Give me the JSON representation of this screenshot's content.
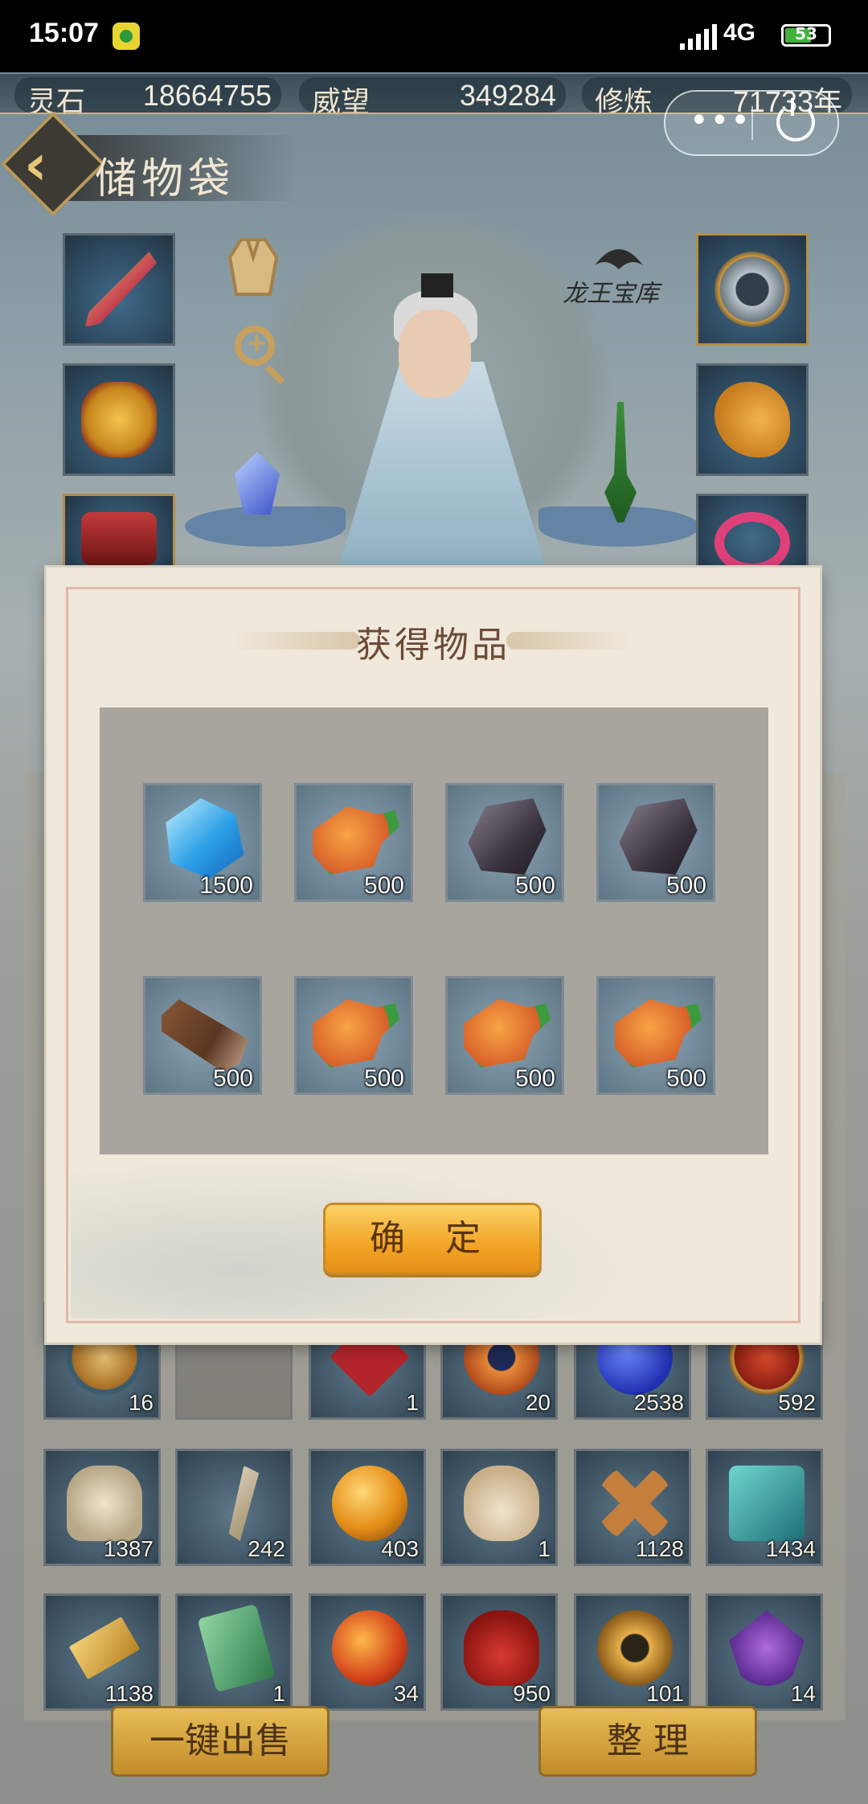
{
  "status_bar": {
    "time": "15:07",
    "network": "4G",
    "battery": "53"
  },
  "resources": [
    {
      "label": "灵石",
      "value": "18664755"
    },
    {
      "label": "威望",
      "value": "349284"
    },
    {
      "label": "修炼",
      "value": "71733年"
    }
  ],
  "header": {
    "title": "储物袋",
    "vault_label": "龙王宝库"
  },
  "capsule": {
    "more": "•••"
  },
  "modal": {
    "title": "获得物品",
    "confirm_label": "确 定",
    "items": [
      {
        "icon": "blue-crystal",
        "count": "1500"
      },
      {
        "icon": "roast-meat",
        "count": "500"
      },
      {
        "icon": "dark-ore",
        "count": "500"
      },
      {
        "icon": "dark-ore",
        "count": "500"
      },
      {
        "icon": "wood-log",
        "count": "500"
      },
      {
        "icon": "roast-meat",
        "count": "500"
      },
      {
        "icon": "roast-meat",
        "count": "500"
      },
      {
        "icon": "roast-meat",
        "count": "500"
      }
    ]
  },
  "inventory": {
    "row1": [
      {
        "icon": "gold-swirl",
        "count": "16"
      },
      {
        "icon": "empty",
        "count": ""
      },
      {
        "icon": "red-charm",
        "count": "1"
      },
      {
        "icon": "orange-lantern",
        "count": "20"
      },
      {
        "icon": "blue-orb",
        "count": "2538"
      },
      {
        "icon": "red-cage-orb",
        "count": "592"
      }
    ],
    "row2": [
      {
        "icon": "beast-skull",
        "count": "1387"
      },
      {
        "icon": "fang",
        "count": "242"
      },
      {
        "icon": "golden-orb",
        "count": "403"
      },
      {
        "icon": "money-bag",
        "count": "1"
      },
      {
        "icon": "bronze-x",
        "count": "1128"
      },
      {
        "icon": "teal-crystal",
        "count": "1434"
      }
    ],
    "row3": [
      {
        "icon": "gold-bars",
        "count": "1138"
      },
      {
        "icon": "jade-token",
        "count": "1"
      },
      {
        "icon": "fire-orb",
        "count": "34"
      },
      {
        "icon": "treasure-bag",
        "count": "950"
      },
      {
        "icon": "amber-ring",
        "count": "101"
      },
      {
        "icon": "purple-amulet",
        "count": "14"
      }
    ]
  },
  "buttons": {
    "sell_all": "一键出售",
    "sort": "整 理"
  },
  "colors": {
    "accent": "#f2a526",
    "title_text": "#6b4a36"
  }
}
